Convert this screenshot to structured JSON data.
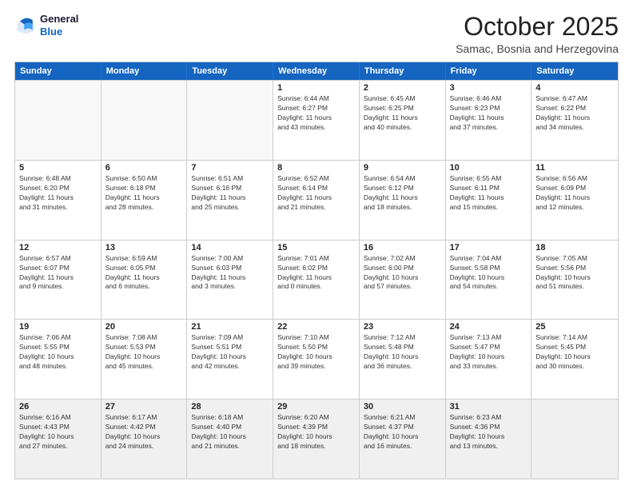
{
  "logo": {
    "line1": "General",
    "line2": "Blue"
  },
  "title": "October 2025",
  "subtitle": "Samac, Bosnia and Herzegovina",
  "days_of_week": [
    "Sunday",
    "Monday",
    "Tuesday",
    "Wednesday",
    "Thursday",
    "Friday",
    "Saturday"
  ],
  "weeks": [
    [
      {
        "day": "",
        "info": ""
      },
      {
        "day": "",
        "info": ""
      },
      {
        "day": "",
        "info": ""
      },
      {
        "day": "1",
        "info": "Sunrise: 6:44 AM\nSunset: 6:27 PM\nDaylight: 11 hours\nand 43 minutes."
      },
      {
        "day": "2",
        "info": "Sunrise: 6:45 AM\nSunset: 6:25 PM\nDaylight: 11 hours\nand 40 minutes."
      },
      {
        "day": "3",
        "info": "Sunrise: 6:46 AM\nSunset: 6:23 PM\nDaylight: 11 hours\nand 37 minutes."
      },
      {
        "day": "4",
        "info": "Sunrise: 6:47 AM\nSunset: 6:22 PM\nDaylight: 11 hours\nand 34 minutes."
      }
    ],
    [
      {
        "day": "5",
        "info": "Sunrise: 6:48 AM\nSunset: 6:20 PM\nDaylight: 11 hours\nand 31 minutes."
      },
      {
        "day": "6",
        "info": "Sunrise: 6:50 AM\nSunset: 6:18 PM\nDaylight: 11 hours\nand 28 minutes."
      },
      {
        "day": "7",
        "info": "Sunrise: 6:51 AM\nSunset: 6:16 PM\nDaylight: 11 hours\nand 25 minutes."
      },
      {
        "day": "8",
        "info": "Sunrise: 6:52 AM\nSunset: 6:14 PM\nDaylight: 11 hours\nand 21 minutes."
      },
      {
        "day": "9",
        "info": "Sunrise: 6:54 AM\nSunset: 6:12 PM\nDaylight: 11 hours\nand 18 minutes."
      },
      {
        "day": "10",
        "info": "Sunrise: 6:55 AM\nSunset: 6:11 PM\nDaylight: 11 hours\nand 15 minutes."
      },
      {
        "day": "11",
        "info": "Sunrise: 6:56 AM\nSunset: 6:09 PM\nDaylight: 11 hours\nand 12 minutes."
      }
    ],
    [
      {
        "day": "12",
        "info": "Sunrise: 6:57 AM\nSunset: 6:07 PM\nDaylight: 11 hours\nand 9 minutes."
      },
      {
        "day": "13",
        "info": "Sunrise: 6:59 AM\nSunset: 6:05 PM\nDaylight: 11 hours\nand 6 minutes."
      },
      {
        "day": "14",
        "info": "Sunrise: 7:00 AM\nSunset: 6:03 PM\nDaylight: 11 hours\nand 3 minutes."
      },
      {
        "day": "15",
        "info": "Sunrise: 7:01 AM\nSunset: 6:02 PM\nDaylight: 11 hours\nand 0 minutes."
      },
      {
        "day": "16",
        "info": "Sunrise: 7:02 AM\nSunset: 6:00 PM\nDaylight: 10 hours\nand 57 minutes."
      },
      {
        "day": "17",
        "info": "Sunrise: 7:04 AM\nSunset: 5:58 PM\nDaylight: 10 hours\nand 54 minutes."
      },
      {
        "day": "18",
        "info": "Sunrise: 7:05 AM\nSunset: 5:56 PM\nDaylight: 10 hours\nand 51 minutes."
      }
    ],
    [
      {
        "day": "19",
        "info": "Sunrise: 7:06 AM\nSunset: 5:55 PM\nDaylight: 10 hours\nand 48 minutes."
      },
      {
        "day": "20",
        "info": "Sunrise: 7:08 AM\nSunset: 5:53 PM\nDaylight: 10 hours\nand 45 minutes."
      },
      {
        "day": "21",
        "info": "Sunrise: 7:09 AM\nSunset: 5:51 PM\nDaylight: 10 hours\nand 42 minutes."
      },
      {
        "day": "22",
        "info": "Sunrise: 7:10 AM\nSunset: 5:50 PM\nDaylight: 10 hours\nand 39 minutes."
      },
      {
        "day": "23",
        "info": "Sunrise: 7:12 AM\nSunset: 5:48 PM\nDaylight: 10 hours\nand 36 minutes."
      },
      {
        "day": "24",
        "info": "Sunrise: 7:13 AM\nSunset: 5:47 PM\nDaylight: 10 hours\nand 33 minutes."
      },
      {
        "day": "25",
        "info": "Sunrise: 7:14 AM\nSunset: 5:45 PM\nDaylight: 10 hours\nand 30 minutes."
      }
    ],
    [
      {
        "day": "26",
        "info": "Sunrise: 6:16 AM\nSunset: 4:43 PM\nDaylight: 10 hours\nand 27 minutes."
      },
      {
        "day": "27",
        "info": "Sunrise: 6:17 AM\nSunset: 4:42 PM\nDaylight: 10 hours\nand 24 minutes."
      },
      {
        "day": "28",
        "info": "Sunrise: 6:18 AM\nSunset: 4:40 PM\nDaylight: 10 hours\nand 21 minutes."
      },
      {
        "day": "29",
        "info": "Sunrise: 6:20 AM\nSunset: 4:39 PM\nDaylight: 10 hours\nand 18 minutes."
      },
      {
        "day": "30",
        "info": "Sunrise: 6:21 AM\nSunset: 4:37 PM\nDaylight: 10 hours\nand 16 minutes."
      },
      {
        "day": "31",
        "info": "Sunrise: 6:23 AM\nSunset: 4:36 PM\nDaylight: 10 hours\nand 13 minutes."
      },
      {
        "day": "",
        "info": ""
      }
    ]
  ]
}
